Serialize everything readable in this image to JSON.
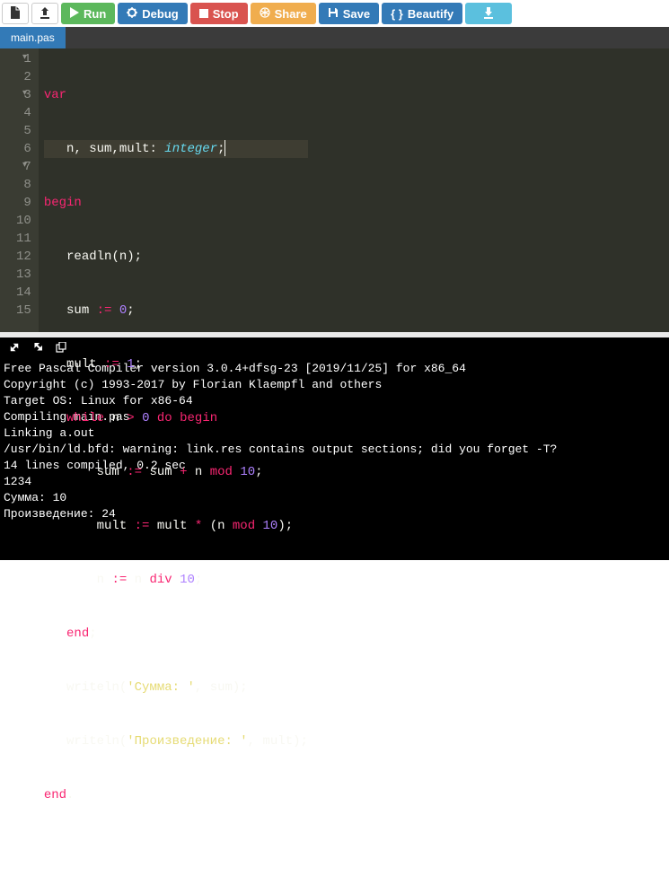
{
  "toolbar": {
    "run": "Run",
    "debug": "Debug",
    "stop": "Stop",
    "share": "Share",
    "save": "Save",
    "beautify": "Beautify"
  },
  "tab": {
    "name": "main.pas"
  },
  "editor": {
    "lines": [
      {
        "n": 1,
        "fold": true
      },
      {
        "n": 2
      },
      {
        "n": 3,
        "fold": true
      },
      {
        "n": 4
      },
      {
        "n": 5
      },
      {
        "n": 6
      },
      {
        "n": 7,
        "fold": true
      },
      {
        "n": 8
      },
      {
        "n": 9
      },
      {
        "n": 10
      },
      {
        "n": 11
      },
      {
        "n": 12
      },
      {
        "n": 13
      },
      {
        "n": 14
      },
      {
        "n": 15
      }
    ],
    "tokens": {
      "var": "var",
      "n": "n",
      "sum": "sum",
      "mult": "mult",
      "integer": "integer",
      "begin": "begin",
      "readln": "readln",
      "zero": "0",
      "one": "1",
      "while": "while",
      "gt": ">",
      "do": "do",
      "mod": "mod",
      "ten": "10",
      "star": "*",
      "plus": "+",
      "div": "div",
      "end_semi": "end",
      "writeln": "writeln",
      "str_sum": "'Сумма: '",
      "str_prod": "'Произведение: '",
      "end_dot": "end"
    }
  },
  "console": {
    "lines": [
      "Free Pascal Compiler version 3.0.4+dfsg-23 [2019/11/25] for x86_64",
      "Copyright (c) 1993-2017 by Florian Klaempfl and others",
      "Target OS: Linux for x86-64",
      "Compiling main.pas",
      "Linking a.out",
      "/usr/bin/ld.bfd: warning: link.res contains output sections; did you forget -T?",
      "14 lines compiled, 0.2 sec",
      "1234",
      "Сумма: 10",
      "Произведение: 24"
    ]
  }
}
